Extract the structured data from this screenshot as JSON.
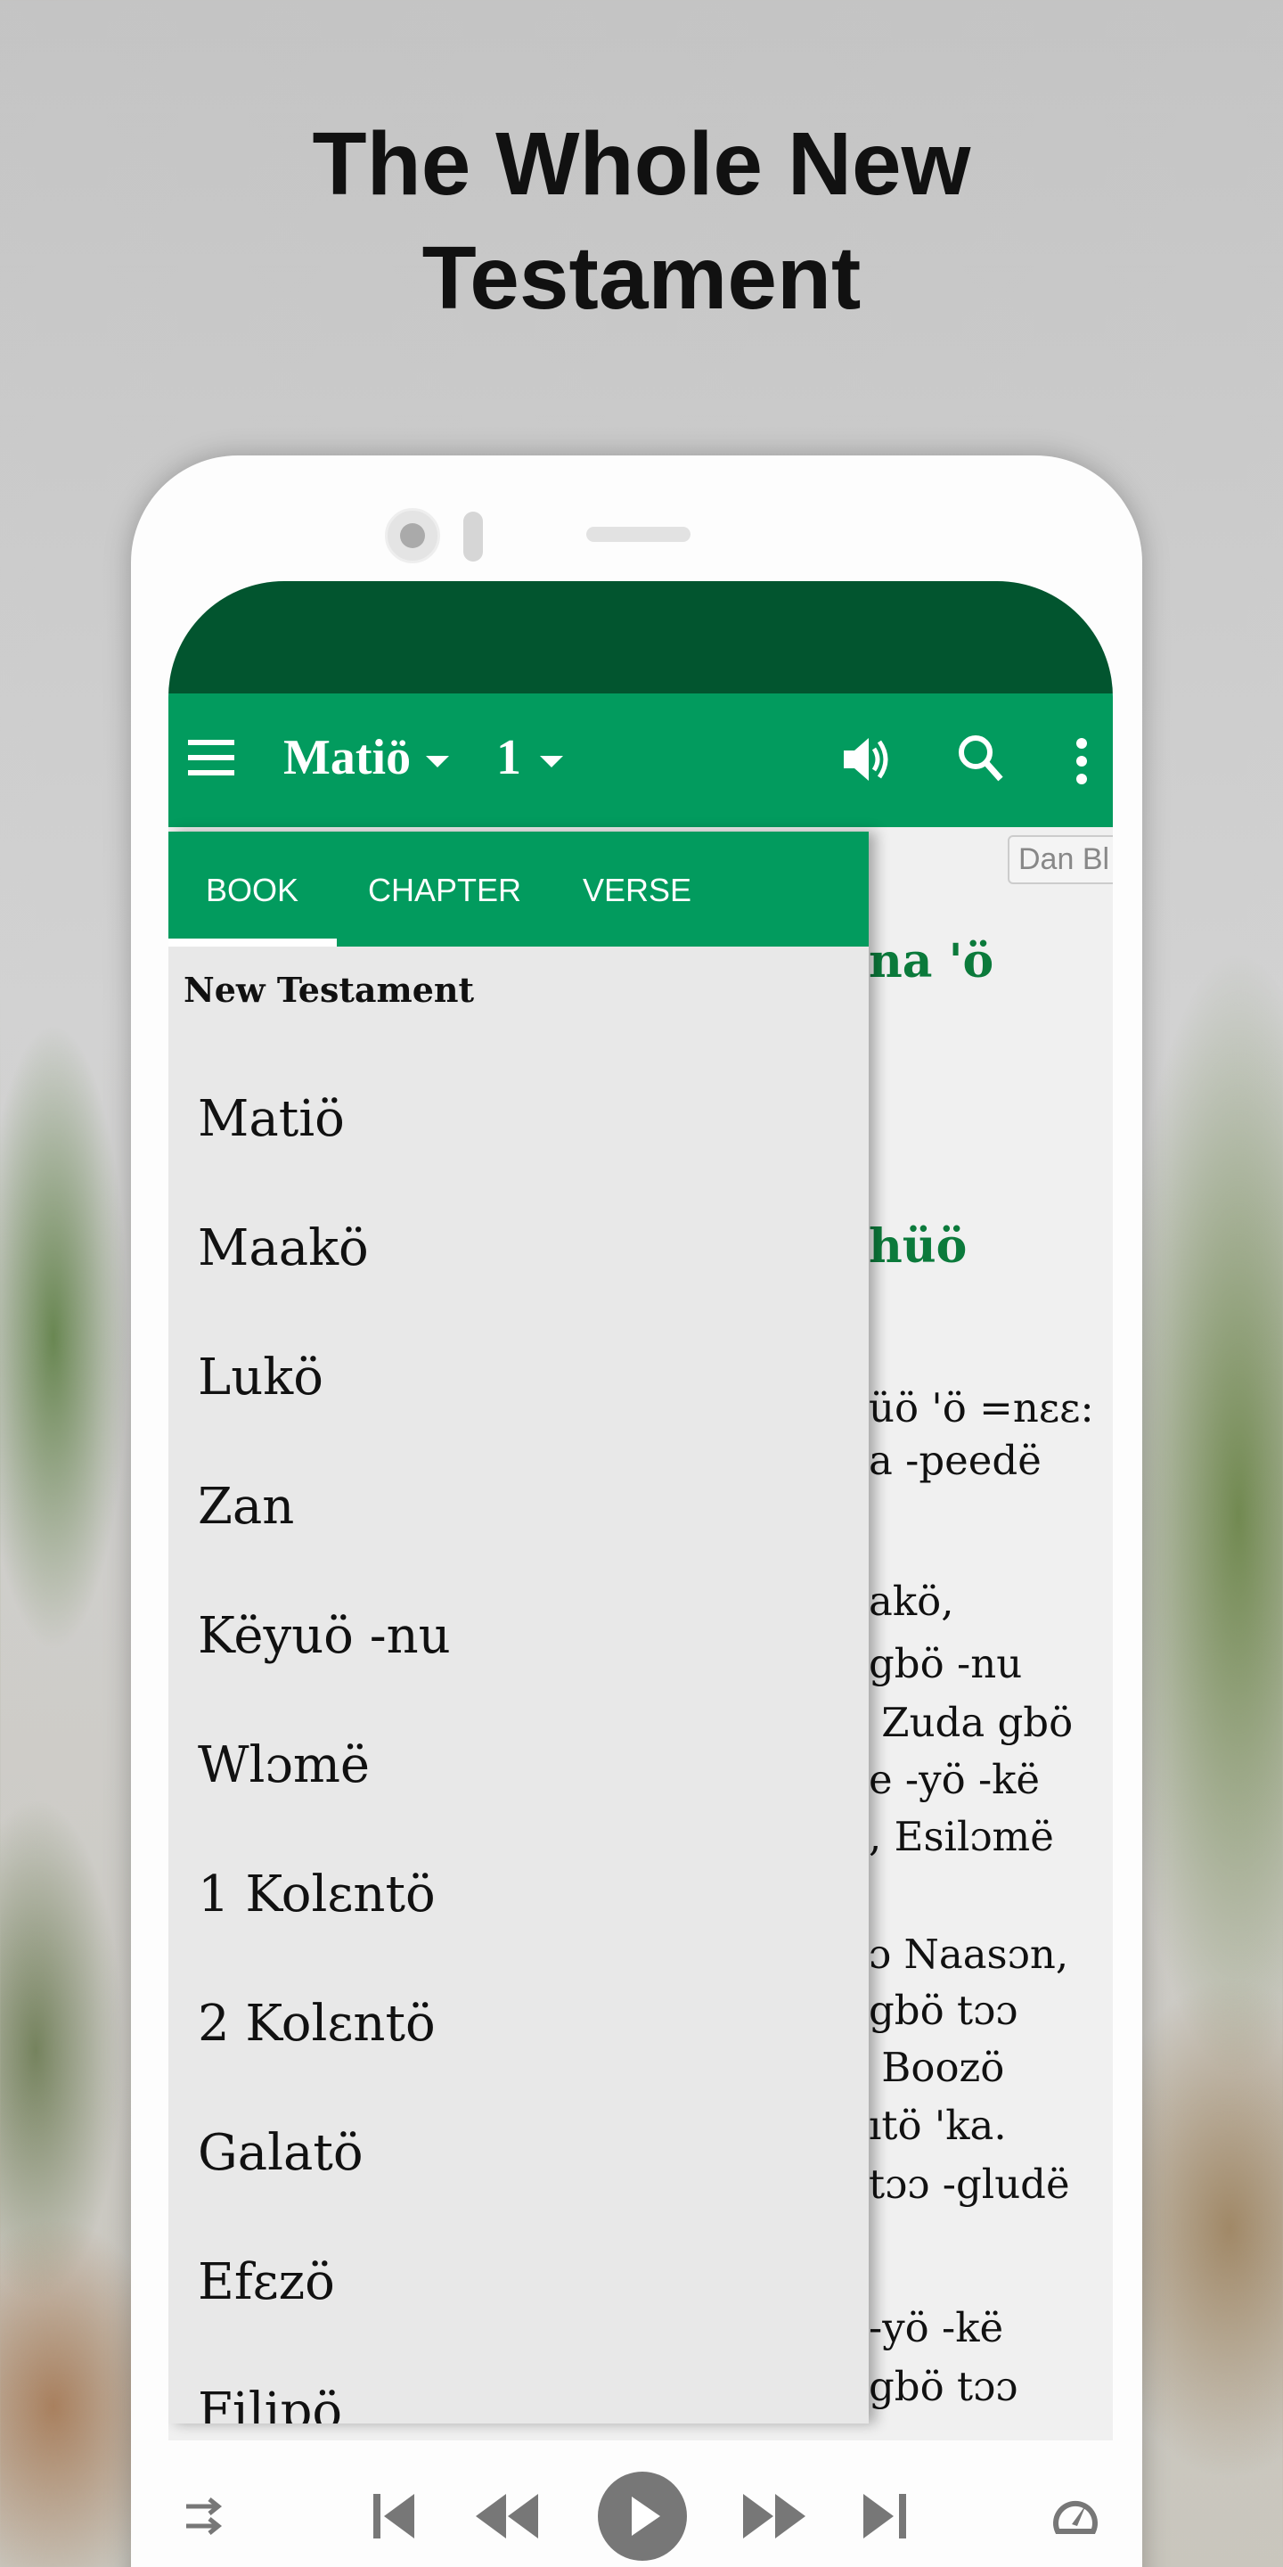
{
  "promo": {
    "title_line1": "The Whole New",
    "title_line2": "Testament"
  },
  "toolbar": {
    "book": "Matiö",
    "chapter": "1",
    "icons": [
      "menu-icon",
      "volume-icon",
      "search-icon",
      "more-vert-icon"
    ]
  },
  "drawer": {
    "tabs": [
      {
        "label": "BOOK",
        "active": true
      },
      {
        "label": "CHAPTER",
        "active": false
      },
      {
        "label": "VERSE",
        "active": false
      }
    ],
    "section_title": "New Testament",
    "books": [
      "Matiö",
      "Maakö",
      "Lukö",
      "Zan",
      "Këyuö -nu",
      "Wlɔmë",
      "1 Kolɛntö",
      "2 Kolɛntö",
      "Galatö",
      "Efɛzö",
      "Filipö"
    ]
  },
  "content": {
    "button_label": "Dan Bl",
    "heading1": "na 'ö",
    "heading2": "hüö",
    "lines": [
      "üö 'ö =nɛɛ:",
      "a -peedë",
      "akö,",
      "gbö -nu",
      " Zuda gbö",
      "e -yö -kë",
      ", Esilɔmë",
      "ɔ Naasɔn,",
      "gbö tɔɔ",
      " Boozö",
      "ıtö 'ka.",
      "tɔɔ -gludë",
      "-yö -kë",
      "gbö tɔɔ"
    ]
  },
  "player": {
    "icons": [
      "shuffle-icon",
      "skip-previous-icon",
      "rewind-icon",
      "play-icon",
      "fast-forward-icon",
      "skip-next-icon",
      "speed-icon"
    ]
  },
  "colors": {
    "primary": "#029b5e",
    "status_bar": "#02552f",
    "heading": "#0b7a3b"
  }
}
